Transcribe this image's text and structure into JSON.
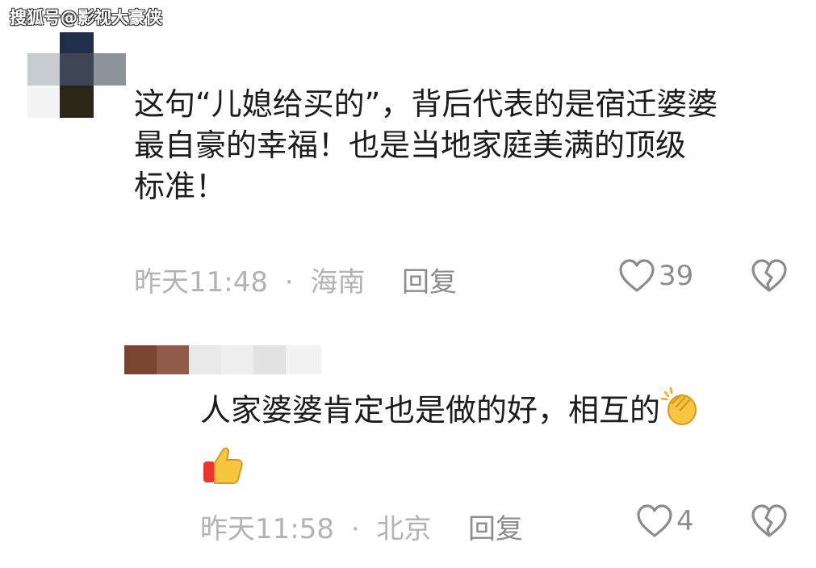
{
  "watermark": "搜狐号@影视大豪侠",
  "comments": [
    {
      "text_lines": [
        "这句“儿媳给买的”，背后代表的是宿迁婆婆",
        "最自豪的幸福！也是当地家庭美满的顶级",
        "标准！"
      ],
      "time": "昨天11:48",
      "separator": "·",
      "location": "海南",
      "reply_label": "回复",
      "likes": "39"
    },
    {
      "text_lines": [
        "人家婆婆肯定也是做的好，相互的"
      ],
      "emojis": [
        "clapping-hands-emoji",
        "thumbs-up-emoji"
      ],
      "time": "昨天11:58",
      "separator": "·",
      "location": "北京",
      "reply_label": "回复",
      "likes": "4"
    }
  ],
  "icons": {
    "like": "heart-outline-icon",
    "dislike": "broken-heart-icon"
  },
  "colors": {
    "meta_text": "#b3b3b3",
    "action_text": "#8c8c8c"
  }
}
